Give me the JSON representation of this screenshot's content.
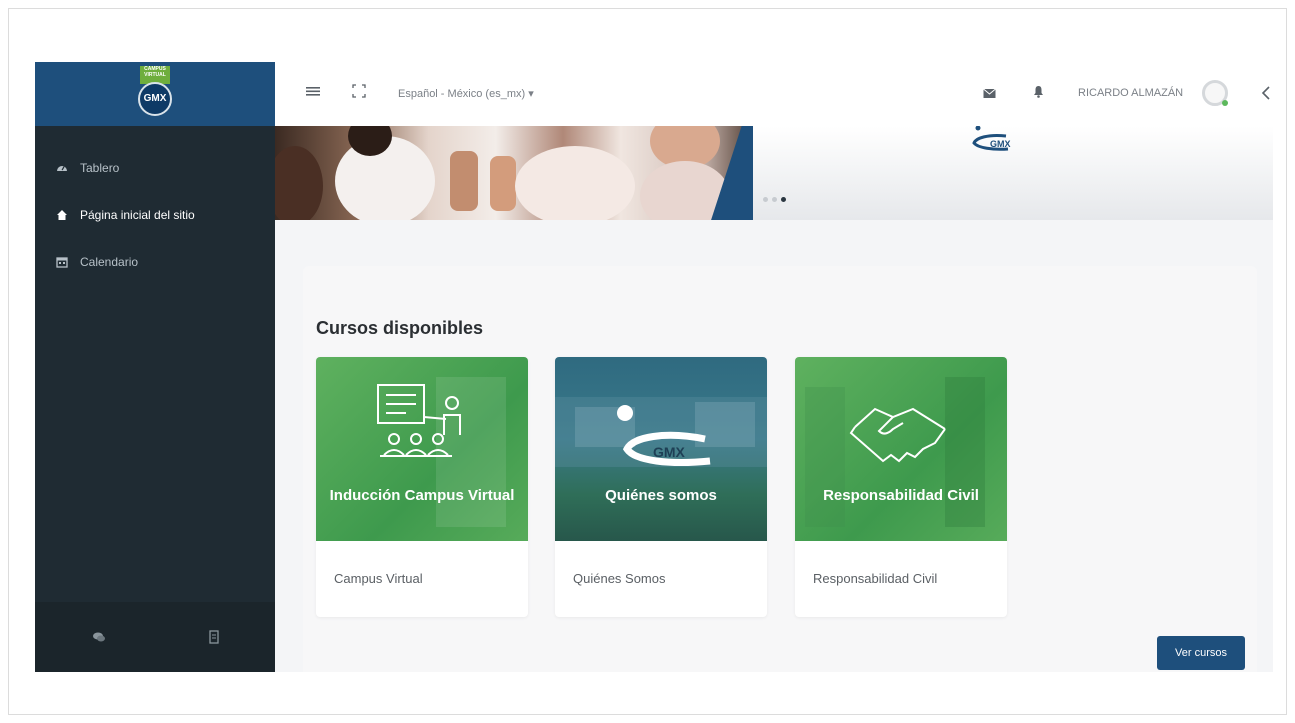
{
  "brand": {
    "flag_text": "CAMPUS VIRTUAL",
    "logo_text": "GMX"
  },
  "sidebar": {
    "items": [
      {
        "label": "Tablero",
        "icon": "tachometer-icon",
        "active": false
      },
      {
        "label": "Página inicial del sitio",
        "icon": "home-icon",
        "active": true
      },
      {
        "label": "Calendario",
        "icon": "calendar-icon",
        "active": false
      }
    ],
    "footer_icons": [
      "chat-icon",
      "document-icon"
    ]
  },
  "topbar": {
    "language": "Español - México (es_mx) ▾",
    "user_name": "RICARDO ALMAZÁN",
    "icons": [
      "hamburger-icon",
      "fullscreen-icon",
      "mail-icon",
      "bell-icon",
      "chevron-left-icon"
    ]
  },
  "banner": {
    "logo_text": "GMX",
    "slides": 3,
    "active_slide": 3
  },
  "courses": {
    "title": "Cursos disponibles",
    "items": [
      {
        "image_text": "Inducción Campus Virtual",
        "name": "Campus Virtual"
      },
      {
        "image_text": "Quiénes somos",
        "name": "Quiénes Somos"
      },
      {
        "image_text": "Responsabilidad Civil",
        "name": "Responsabilidad Civil"
      }
    ],
    "button": "Ver cursos"
  },
  "colors": {
    "brand_blue": "#1e4f7c",
    "sidebar": "#1f2b33",
    "card_green": "#4ea85a"
  }
}
